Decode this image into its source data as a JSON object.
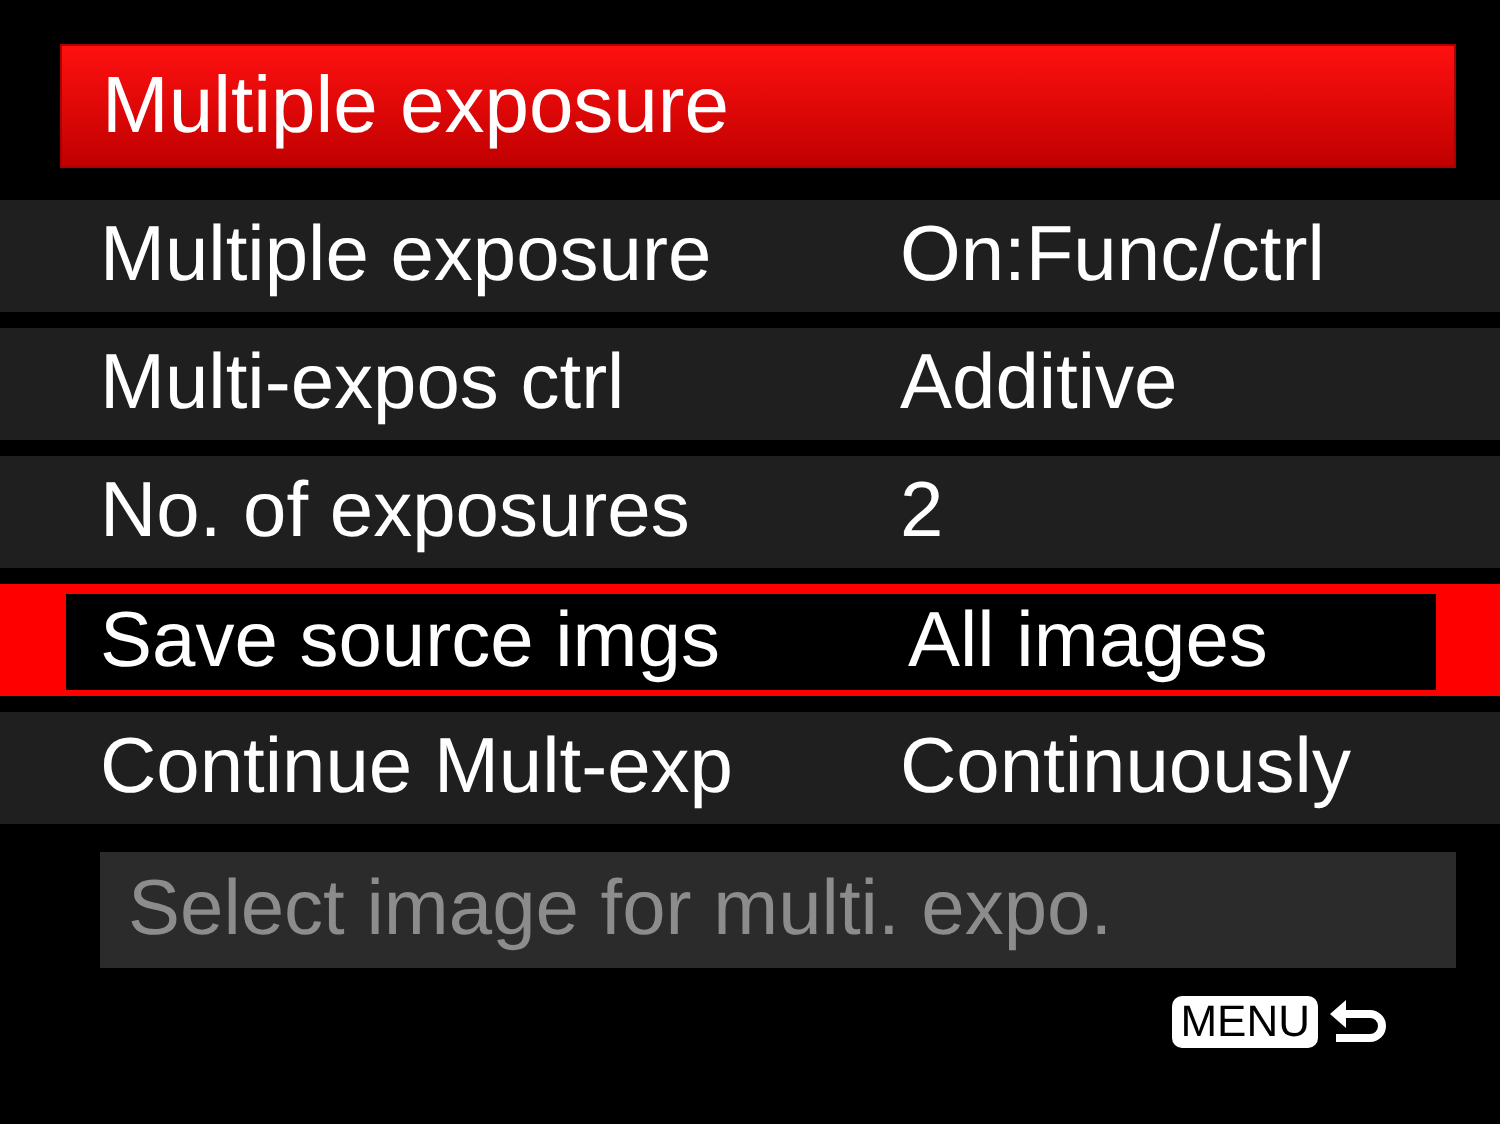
{
  "title": "Multiple exposure",
  "rows": [
    {
      "label": "Multiple exposure",
      "value": "On:Func/ctrl",
      "selected": false
    },
    {
      "label": "Multi-expos ctrl",
      "value": "Additive",
      "selected": false
    },
    {
      "label": "No. of exposures",
      "value": "2",
      "selected": false
    },
    {
      "label": "Save source imgs",
      "value": "All images",
      "selected": true
    },
    {
      "label": "Continue Mult-exp",
      "value": "Continuously",
      "selected": false
    }
  ],
  "hint": "Select image for multi. expo.",
  "menu_key": "MENU"
}
